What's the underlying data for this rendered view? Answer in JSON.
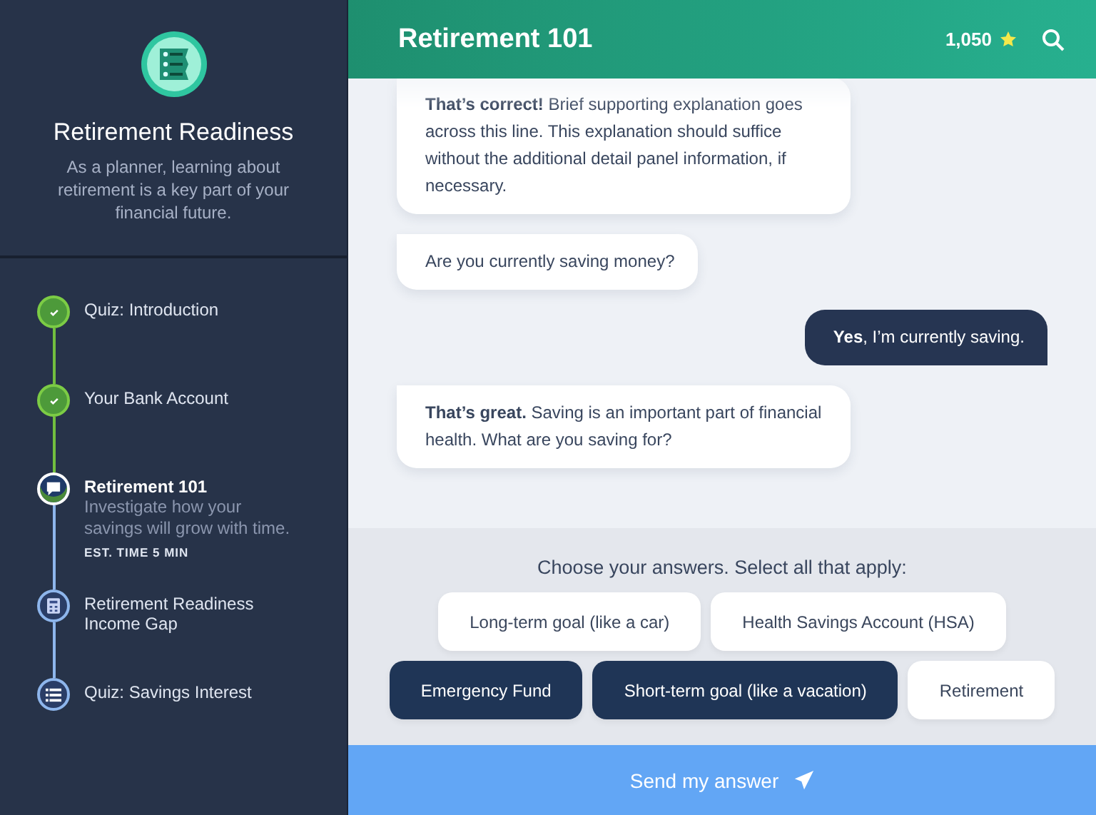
{
  "sidebar": {
    "title": "Retirement Readiness",
    "description": "As a planner, learning about retirement is a key part of your financial future.",
    "steps": [
      {
        "title": "Quiz: Introduction",
        "kind": "check",
        "completed": true,
        "selected": false
      },
      {
        "title": "Your Bank Account",
        "kind": "check",
        "completed": true,
        "selected": false
      },
      {
        "title": "Retirement 101",
        "kind": "chat",
        "completed": false,
        "selected": true,
        "description": "Investigate how your savings will grow with time.",
        "time": "EST. TIME 5 MIN"
      },
      {
        "title": "Retirement Readiness Income Gap",
        "kind": "calculator",
        "completed": false,
        "selected": false
      },
      {
        "title": "Quiz: Savings Interest",
        "kind": "list",
        "completed": false,
        "selected": false
      }
    ]
  },
  "header": {
    "title": "Retirement 101",
    "points": "1,050"
  },
  "messages": [
    {
      "kind": "bot",
      "text": "**That’s correct!** Brief supporting explanation goes across this line. This explanation should suffice without the additional detail panel information, if necessary."
    },
    {
      "kind": "bot",
      "text": "Are you currently saving money?"
    },
    {
      "kind": "user",
      "text": "**Yes**, I’m currently saving."
    },
    {
      "kind": "bot",
      "text": "**That’s great.** Saving is an important part of financial health. What are you saving for?"
    }
  ],
  "answers": {
    "prompt": "Choose your answers. Select all that apply:",
    "choices": [
      {
        "label": "Long-term goal (like a car)",
        "selected": false
      },
      {
        "label": "Health Savings Account (HSA)",
        "selected": false
      },
      {
        "label": "Emergency Fund",
        "selected": true
      },
      {
        "label": "Short-term goal (like a vacation)",
        "selected": true
      },
      {
        "label": "Retirement",
        "selected": false
      }
    ]
  },
  "send_button": "Send my answer"
}
